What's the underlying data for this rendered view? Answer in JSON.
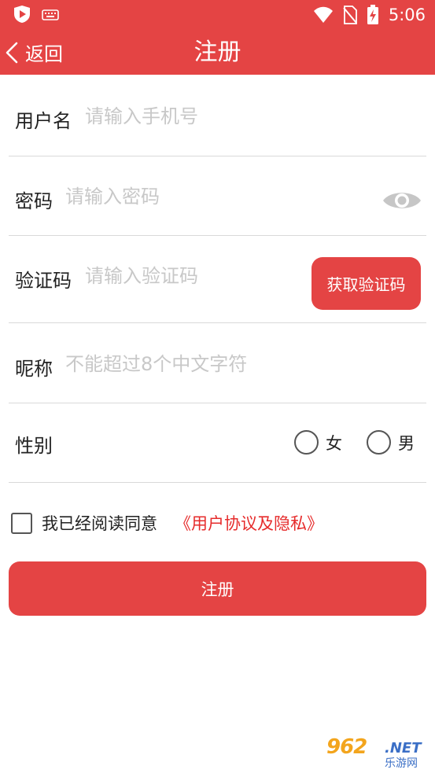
{
  "status_bar": {
    "time": "5:06",
    "icons": [
      "shield-app-icon",
      "keyboard-icon",
      "wifi-icon",
      "no-sim-icon",
      "battery-charging-icon"
    ]
  },
  "nav": {
    "back_label": "返回",
    "title": "注册"
  },
  "form": {
    "username": {
      "label": "用户名",
      "placeholder": "请输入手机号",
      "value": ""
    },
    "password": {
      "label": "密码",
      "placeholder": "请输入密码",
      "value": ""
    },
    "code": {
      "label": "验证码",
      "placeholder": "请输入验证码",
      "value": "",
      "button_label": "获取验证码"
    },
    "nickname": {
      "label": "昵称",
      "placeholder": "不能超过8个中文字符",
      "value": ""
    },
    "gender": {
      "label": "性别",
      "options": [
        "女",
        "男"
      ],
      "selected": null
    }
  },
  "agreement": {
    "checked": false,
    "text": "我已经阅读同意",
    "link": "《用户协议及隐私》"
  },
  "submit_label": "注册",
  "watermark": {
    "number": "962",
    "suffix": ".NET",
    "tagline": "乐游网"
  },
  "colors": {
    "primary": "#e44444",
    "link": "#e62b2b",
    "placeholder": "#c8c8c8",
    "divider": "#d9d9d9"
  }
}
